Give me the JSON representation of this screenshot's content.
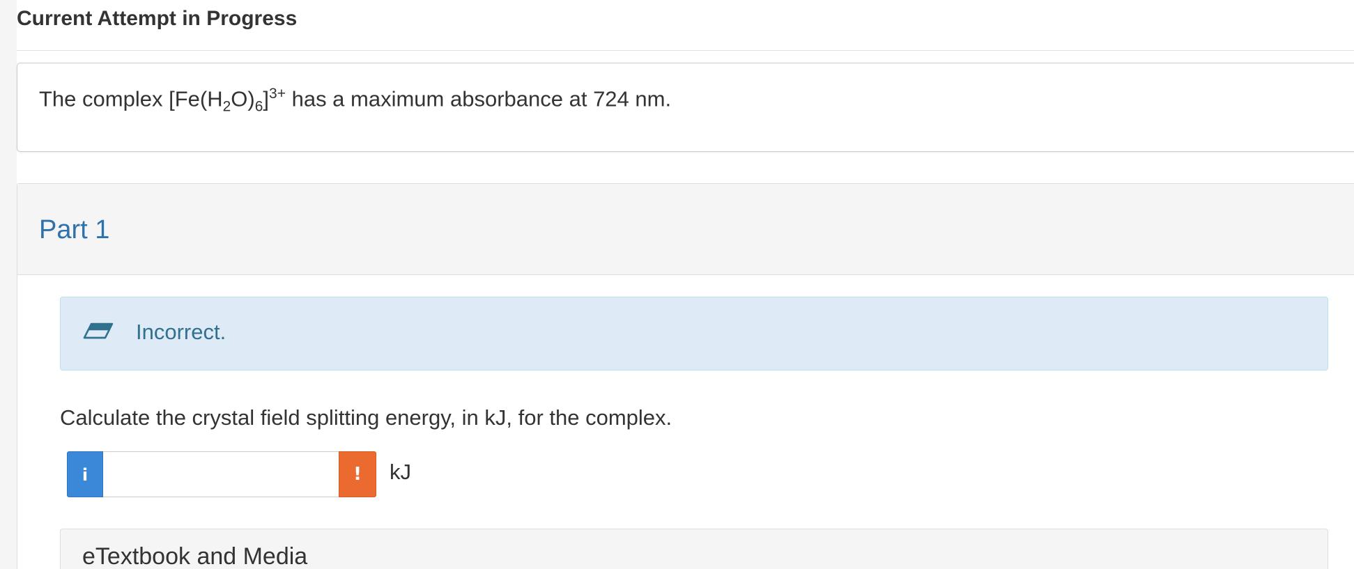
{
  "header": {
    "title": "Current Attempt in Progress"
  },
  "question": {
    "text_prefix": "The complex [Fe(H",
    "sub_1": "2",
    "text_mid_1": "O)",
    "sub_2": "6",
    "text_mid_2": "]",
    "sup_charge": "3+",
    "text_suffix": " has a maximum absorbance at 724 nm."
  },
  "part": {
    "title": "Part 1",
    "feedback": {
      "icon": "eraser-icon",
      "text": "Incorrect."
    },
    "prompt": "Calculate the crystal field splitting energy, in kJ, for the complex.",
    "answer": {
      "info_label": "i",
      "value": "",
      "warning_label": "!",
      "unit": "kJ"
    },
    "resources": {
      "title": "eTextbook and Media"
    }
  },
  "colors": {
    "part_title": "#2d72ac",
    "feedback_bg": "#deebf6",
    "feedback_text": "#31708f",
    "info_button": "#3b87d8",
    "warning_button": "#ea6a2f"
  }
}
